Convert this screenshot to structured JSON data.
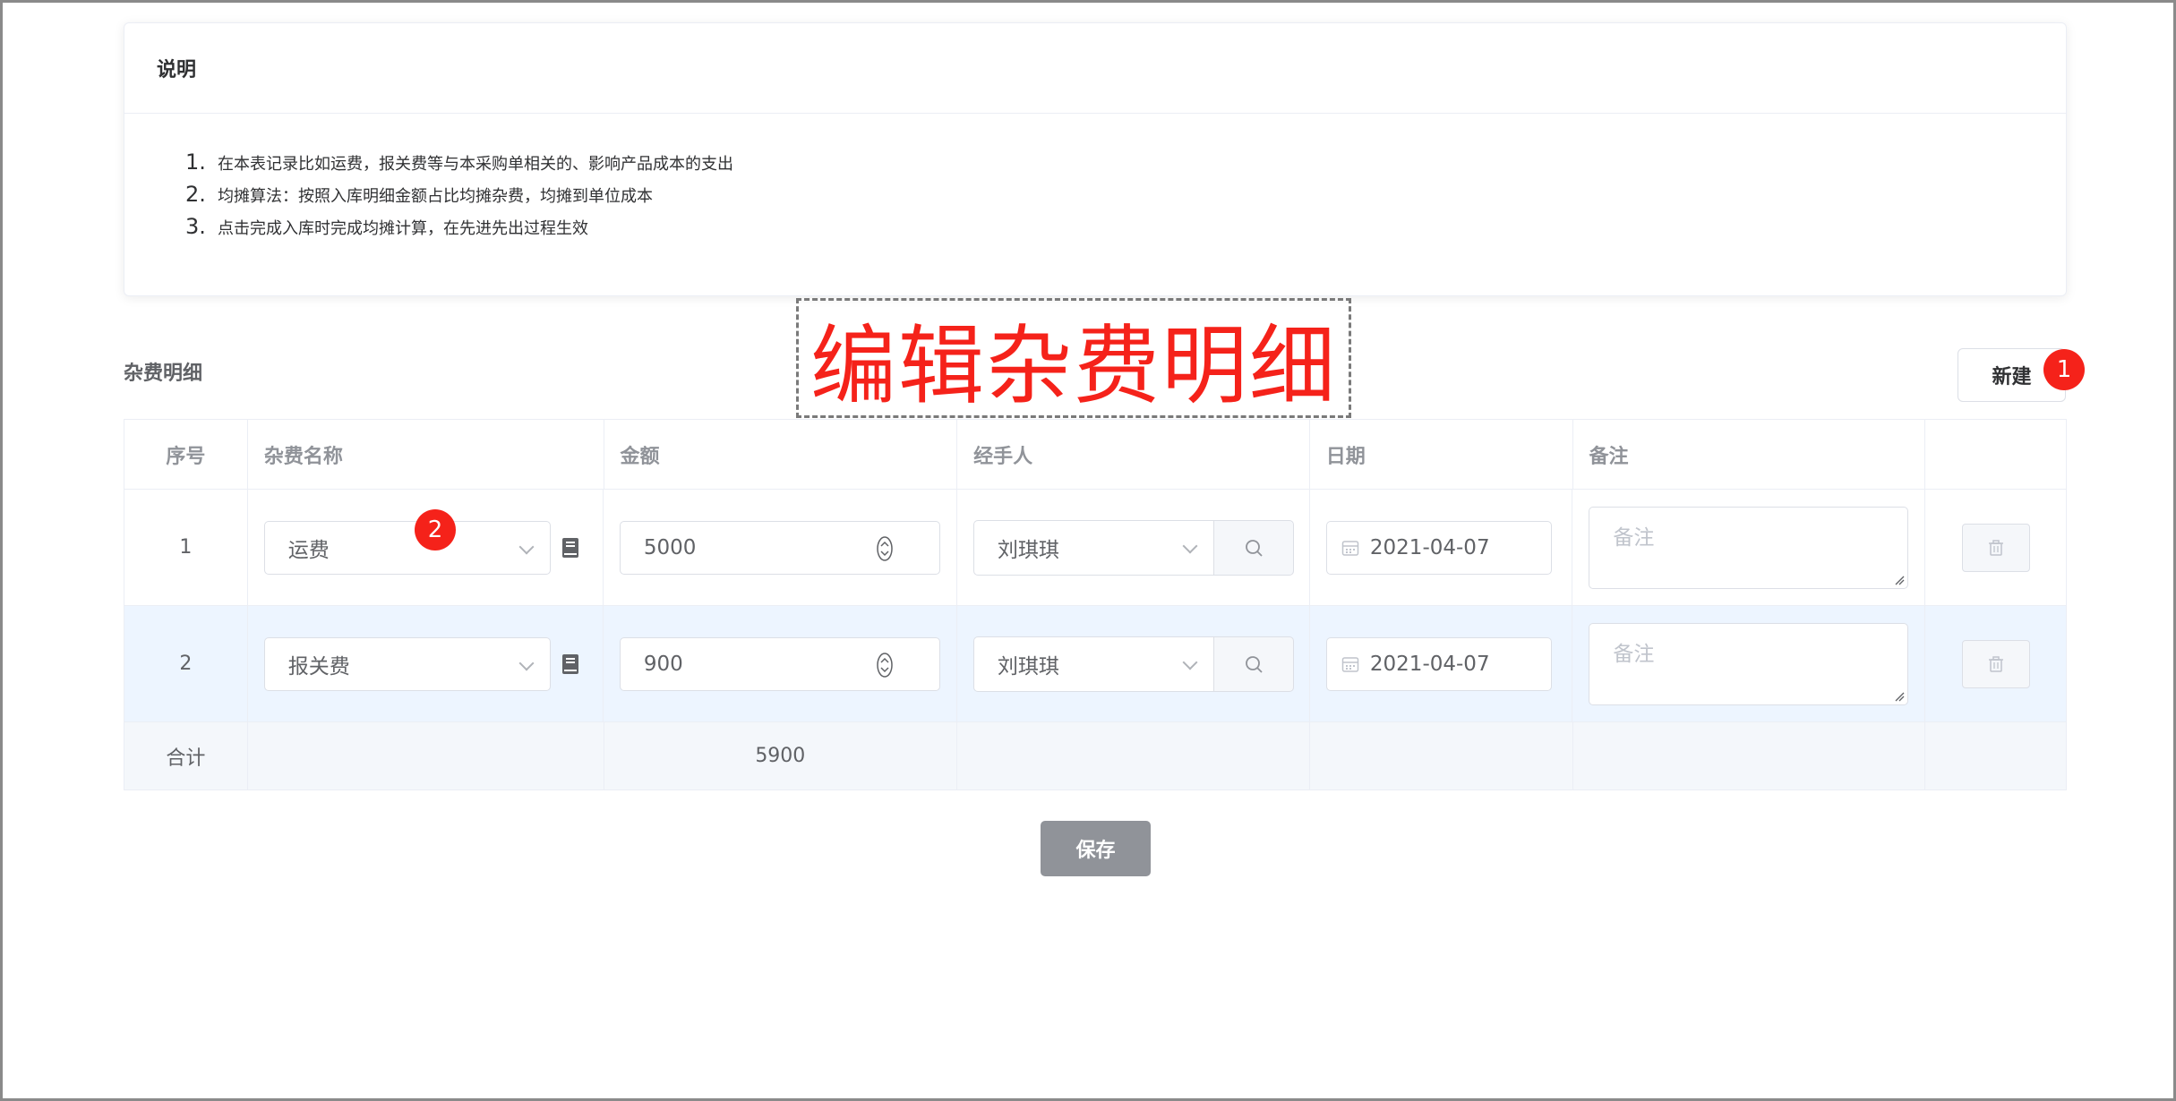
{
  "notes_card": {
    "title": "说明",
    "items": [
      {
        "num": "1.",
        "text": "在本表记录比如运费，报关费等与本采购单相关的、影响产品成本的支出"
      },
      {
        "num": "2.",
        "text": "均摊算法：按照入库明细金额占比均摊杂费，均摊到单位成本"
      },
      {
        "num": "3.",
        "text": "点击完成入库时完成均摊计算，在先进先出过程生效"
      }
    ]
  },
  "callout": {
    "text": "编辑杂费明细"
  },
  "section": {
    "title": "杂费明细",
    "new_button": "新建"
  },
  "badges": {
    "first": "1",
    "second": "2"
  },
  "table": {
    "columns": [
      "序号",
      "杂费名称",
      "金额",
      "经手人",
      "日期",
      "备注",
      ""
    ],
    "rows": [
      {
        "index": "1",
        "fee_name": "运费",
        "amount": "5000",
        "handler": "刘琪琪",
        "date": "2021-04-07",
        "remark_placeholder": "备注"
      },
      {
        "index": "2",
        "fee_name": "报关费",
        "amount": "900",
        "handler": "刘琪琪",
        "date": "2021-04-07",
        "remark_placeholder": "备注"
      }
    ],
    "summary": {
      "label": "合计",
      "amount_total": "5900"
    }
  },
  "save_button": "保存",
  "colors": {
    "accent_red": "#f5221a",
    "row_highlight": "#edf5ff",
    "save_gray": "#909399"
  },
  "icons": [
    "book-icon",
    "stepper-icon",
    "chevron-down-icon",
    "search-icon",
    "calendar-icon",
    "trash-icon",
    "resize-handle-icon"
  ]
}
